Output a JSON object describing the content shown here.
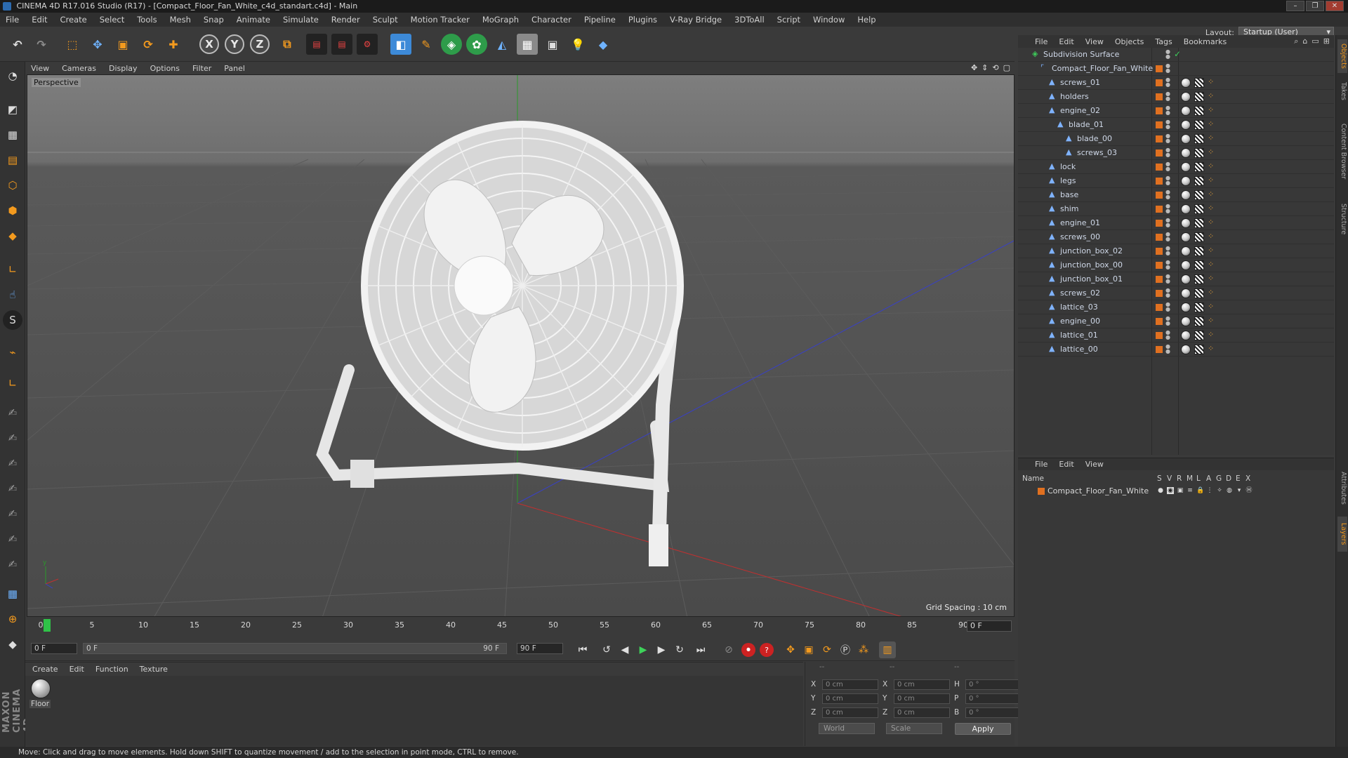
{
  "window": {
    "title": "CINEMA 4D R17.016 Studio (R17) - [Compact_Floor_Fan_White_c4d_standart.c4d] - Main",
    "controls": [
      "–",
      "❐",
      "✕"
    ]
  },
  "menubar": {
    "items": [
      "File",
      "Edit",
      "Create",
      "Select",
      "Tools",
      "Mesh",
      "Snap",
      "Animate",
      "Simulate",
      "Render",
      "Sculpt",
      "Motion Tracker",
      "MoGraph",
      "Character",
      "Pipeline",
      "Plugins",
      "V-Ray Bridge",
      "3DToAll",
      "Script",
      "Window",
      "Help"
    ],
    "layout_label": "Layout:",
    "layout_value": "Startup (User)"
  },
  "toolbar": {
    "icons": [
      "undo-icon",
      "redo-icon",
      "live-selection-icon",
      "move-icon",
      "scale-icon",
      "rotate-icon",
      "add-icon",
      "x-axis-icon",
      "y-axis-icon",
      "z-axis-icon",
      "coordinate-system-icon",
      "render-view-icon",
      "render-picture-viewer-icon",
      "edit-render-settings-icon",
      "cube-icon",
      "spline-pen-icon",
      "subdivision-icon",
      "cloner-icon",
      "deformer-icon",
      "floor-icon",
      "camera-icon",
      "light-icon",
      "python-icon"
    ],
    "axis_labels": [
      "X",
      "Y",
      "Z"
    ]
  },
  "viewport": {
    "menu": [
      "View",
      "Cameras",
      "Display",
      "Options",
      "Filter",
      "Panel"
    ],
    "camera_label": "Perspective",
    "grid_spacing": "Grid Spacing : 10 cm"
  },
  "timeline": {
    "ticks": [
      "0",
      "5",
      "10",
      "15",
      "20",
      "25",
      "30",
      "35",
      "40",
      "45",
      "50",
      "55",
      "60",
      "65",
      "70",
      "75",
      "80",
      "85",
      "90"
    ],
    "current_frame": "0 F"
  },
  "transport": {
    "start_field": "0 F",
    "range_start": "0 F",
    "range_end": "90 F",
    "end_field": "90 F"
  },
  "material_manager": {
    "menu": [
      "Create",
      "Edit",
      "Function",
      "Texture"
    ],
    "materials": [
      {
        "name": "Floor"
      }
    ]
  },
  "coordinates": {
    "headers": [
      "--",
      "--",
      "--"
    ],
    "rows": [
      {
        "axis": "X",
        "pos": "0 cm",
        "size_axis": "X",
        "size": "0 cm",
        "rot_axis": "H",
        "rot": "0 °"
      },
      {
        "axis": "Y",
        "pos": "0 cm",
        "size_axis": "Y",
        "size": "0 cm",
        "rot_axis": "P",
        "rot": "0 °"
      },
      {
        "axis": "Z",
        "pos": "0 cm",
        "size_axis": "Z",
        "size": "0 cm",
        "rot_axis": "B",
        "rot": "0 °"
      }
    ],
    "mode": "World",
    "size_mode": "Scale",
    "apply": "Apply"
  },
  "object_manager": {
    "menu": [
      "File",
      "Edit",
      "View",
      "Objects",
      "Tags",
      "Bookmarks"
    ],
    "objects": [
      {
        "name": "Subdivision Surface",
        "type": "subdivision"
      },
      {
        "name": "Compact_Floor_Fan_White",
        "type": "null"
      },
      {
        "name": "screws_01",
        "type": "mesh"
      },
      {
        "name": "holders",
        "type": "mesh"
      },
      {
        "name": "engine_02",
        "type": "mesh"
      },
      {
        "name": "blade_01",
        "type": "mesh"
      },
      {
        "name": "blade_00",
        "type": "mesh"
      },
      {
        "name": "screws_03",
        "type": "mesh"
      },
      {
        "name": "lock",
        "type": "mesh"
      },
      {
        "name": "legs",
        "type": "mesh"
      },
      {
        "name": "base",
        "type": "mesh"
      },
      {
        "name": "shim",
        "type": "mesh"
      },
      {
        "name": "engine_01",
        "type": "mesh"
      },
      {
        "name": "screws_00",
        "type": "mesh"
      },
      {
        "name": "junction_box_02",
        "type": "mesh"
      },
      {
        "name": "junction_box_00",
        "type": "mesh"
      },
      {
        "name": "junction_box_01",
        "type": "mesh"
      },
      {
        "name": "screws_02",
        "type": "mesh"
      },
      {
        "name": "lattice_03",
        "type": "mesh"
      },
      {
        "name": "engine_00",
        "type": "mesh"
      },
      {
        "name": "lattice_01",
        "type": "mesh"
      },
      {
        "name": "lattice_00",
        "type": "mesh"
      }
    ]
  },
  "layer_manager": {
    "menu": [
      "File",
      "Edit",
      "View"
    ],
    "columns": [
      "Name",
      "S",
      "V",
      "R",
      "M",
      "L",
      "A",
      "G",
      "D",
      "E",
      "X"
    ],
    "layers": [
      {
        "name": "Compact_Floor_Fan_White",
        "color": "#e07020"
      }
    ]
  },
  "side_tabs": [
    "Objects",
    "Takes",
    "Content Browser",
    "Structure",
    "Attributes",
    "Layers"
  ],
  "status": "Move: Click and drag to move elements. Hold down SHIFT to quantize movement / add to the selection in point mode, CTRL to remove.",
  "brand": "MAXON CINEMA 4D",
  "colors": {
    "accent": "#f39a1e",
    "layer": "#e07020",
    "play": "#3ed25a"
  }
}
